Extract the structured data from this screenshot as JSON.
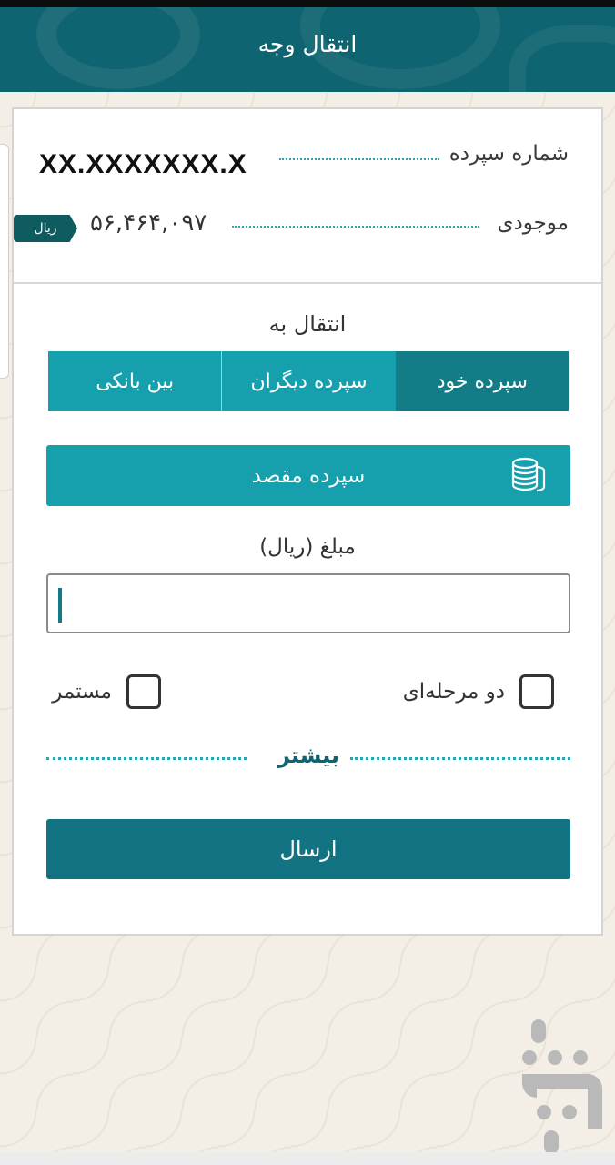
{
  "header": {
    "title": "انتقال وجه"
  },
  "account": {
    "number_label": "شماره سپرده",
    "number_value": "XX.XXXXXXX.X",
    "balance_label": "موجودی",
    "balance_value": "۵۶,۴۶۴,۰۹۷",
    "currency": "ریال"
  },
  "transfer": {
    "to_label": "انتقال به",
    "tabs": [
      {
        "label": "سپرده خود",
        "active": true
      },
      {
        "label": "سپرده دیگران",
        "active": false
      },
      {
        "label": "بین بانکی",
        "active": false
      }
    ],
    "destination_button": "سپرده مقصد",
    "destination_icon": "coins-stack-icon",
    "amount_label": "مبلغ (ریال)",
    "amount_value": ""
  },
  "options": {
    "two_step_label": "دو مرحله‌ای",
    "two_step_checked": false,
    "recurring_label": "مستمر",
    "recurring_checked": false
  },
  "more_label": "بیشتر",
  "send_label": "ارسال",
  "colors": {
    "header": "#0e6470",
    "tab": "#16a0ae",
    "tab_active": "#127c87",
    "send_button": "#127482",
    "accent_line": "#2fa3b2"
  }
}
